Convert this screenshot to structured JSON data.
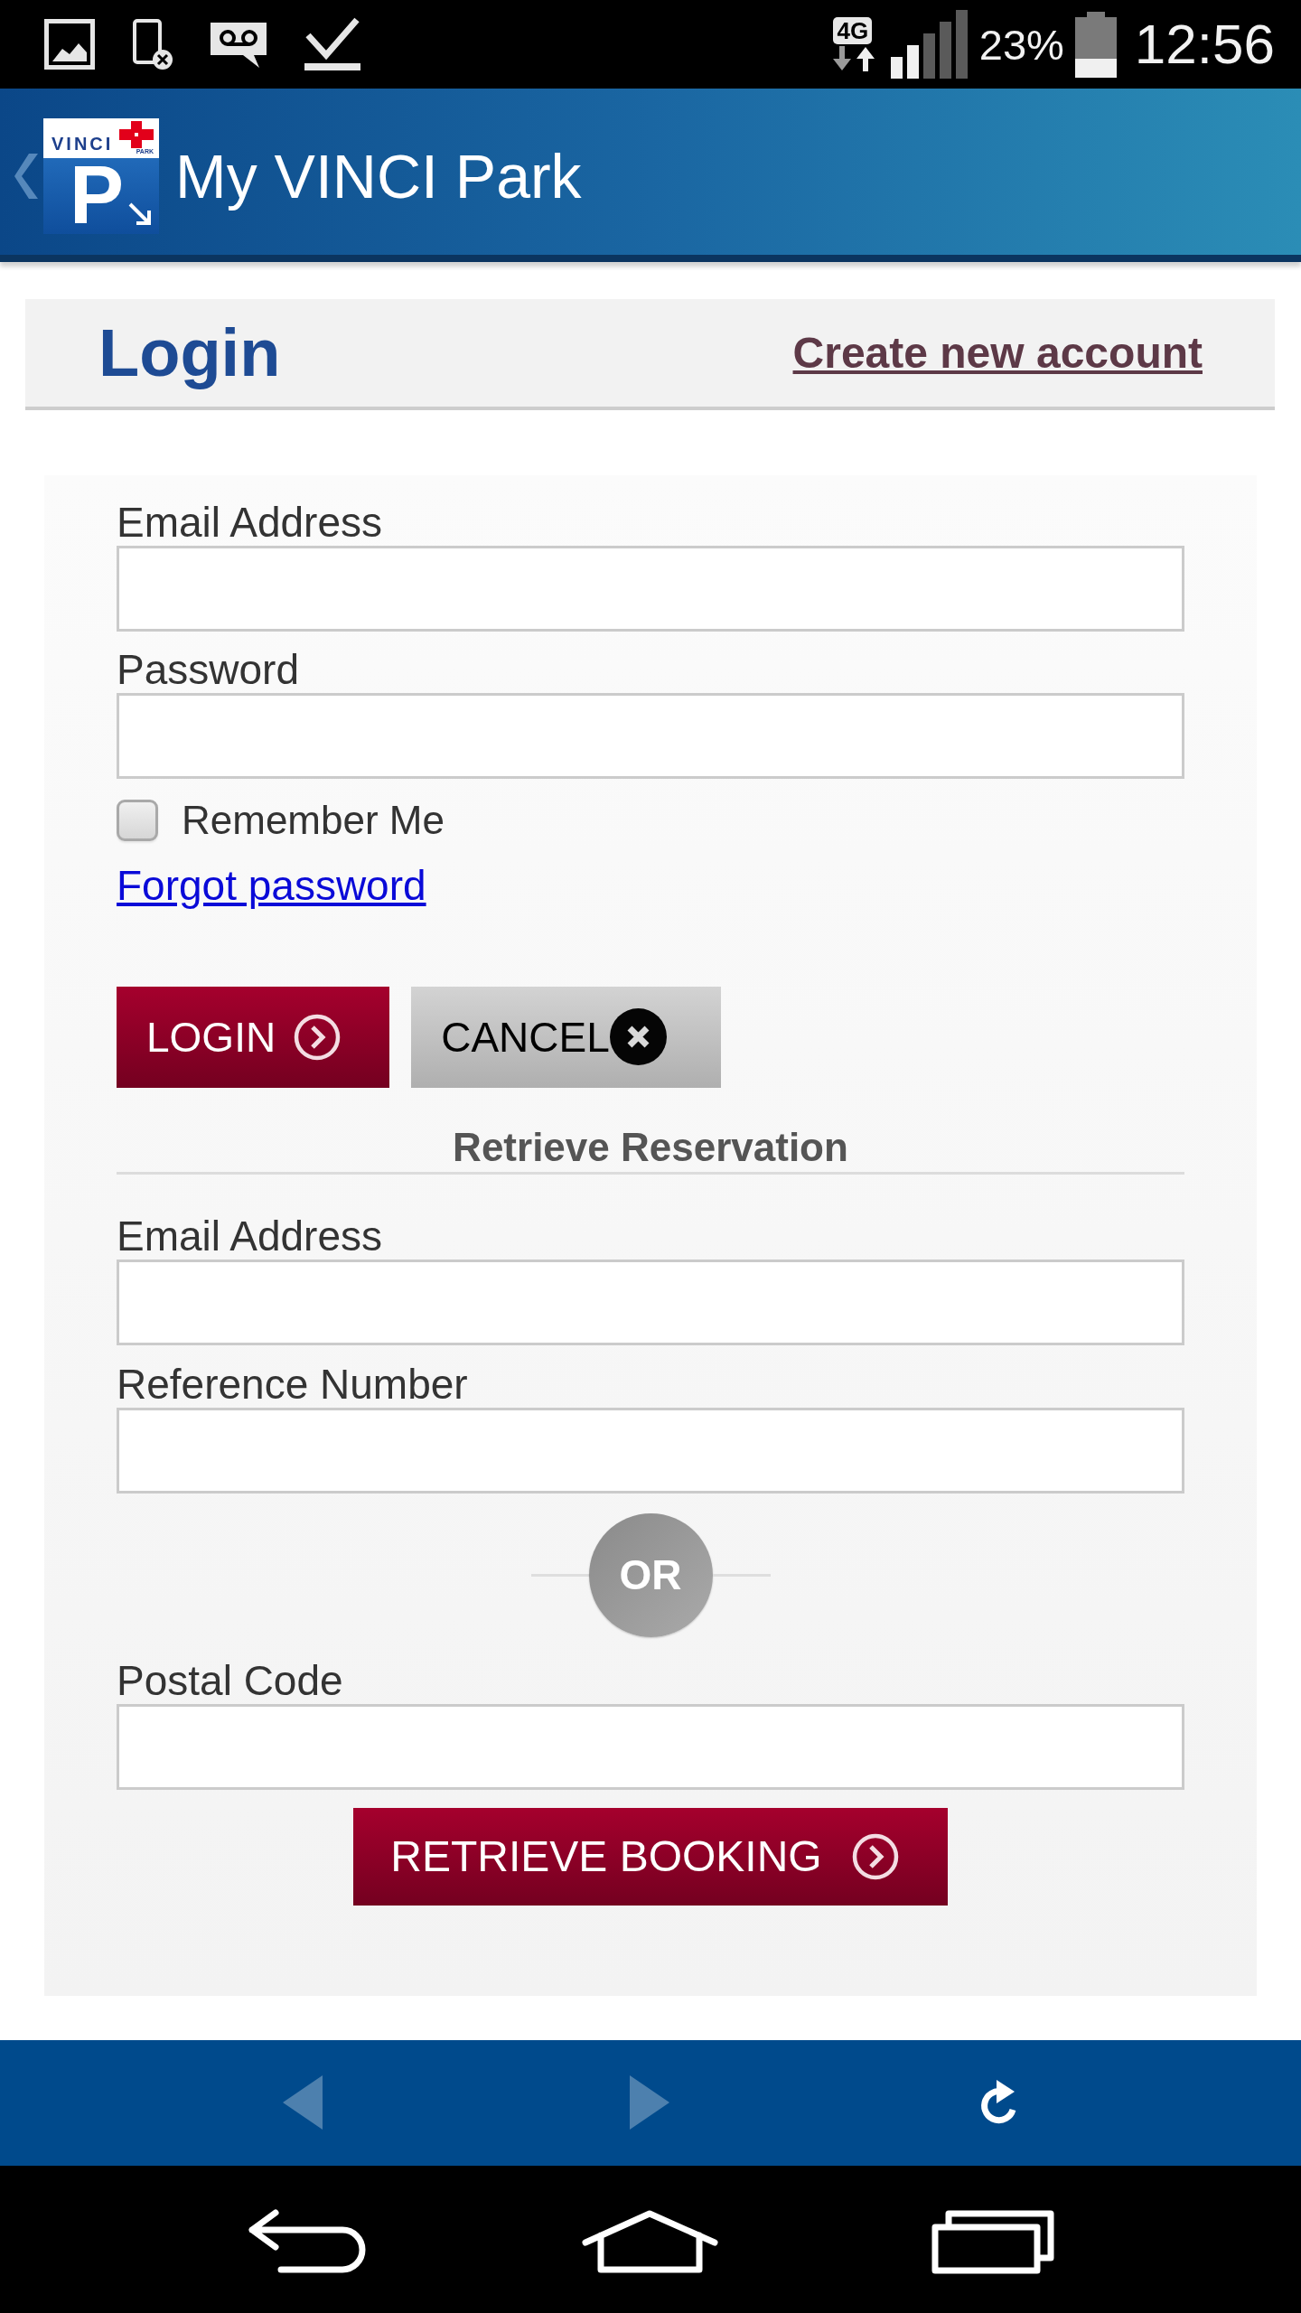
{
  "status_bar": {
    "network": "4G",
    "battery": "23%",
    "time": "12:56"
  },
  "header": {
    "logo": {
      "brand": "VINCI",
      "sub": "PARK",
      "letter": "P"
    },
    "title": "My VINCI Park"
  },
  "login": {
    "title": "Login",
    "create_account_link": "Create new account",
    "fields": [
      {
        "label": "Email Address"
      },
      {
        "label": "Password"
      }
    ],
    "remember_me": {
      "label": "Remember Me",
      "checked": false
    },
    "forgot_password_link": "Forgot password",
    "buttons": [
      {
        "kind": "primary",
        "label": "LOGIN"
      },
      {
        "kind": "cancel",
        "label": "CANCEL"
      }
    ]
  },
  "retrieve_reservation": {
    "title": "Retrieve Reservation",
    "fields": [
      {
        "label": "Email Address"
      },
      {
        "label": "Reference Number"
      }
    ],
    "separator": "OR",
    "postal_field": {
      "label": "Postal Code"
    },
    "button": {
      "kind": "primary",
      "label": "RETRIEVE BOOKING"
    }
  },
  "toolbar": {
    "items": [
      {
        "kind": "back",
        "disabled": true
      },
      {
        "kind": "forward",
        "disabled": true
      },
      {
        "kind": "refresh",
        "disabled": false
      }
    ]
  }
}
